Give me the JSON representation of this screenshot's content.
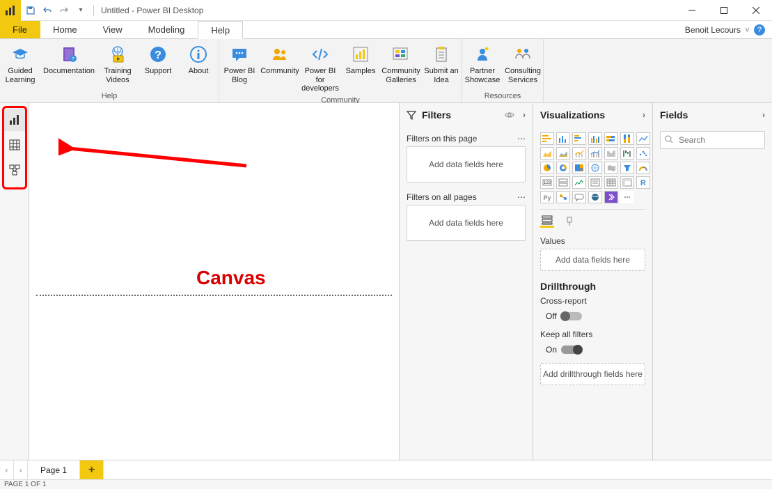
{
  "title": "Untitled - Power BI Desktop",
  "user": "Benoit Lecours",
  "menu": {
    "file": "File",
    "home": "Home",
    "view": "View",
    "modeling": "Modeling",
    "help": "Help"
  },
  "ribbon": {
    "groups": {
      "help": {
        "label": "Help",
        "guided_learning": "Guided Learning",
        "documentation": "Documentation",
        "training_videos": "Training Videos",
        "support": "Support",
        "about": "About"
      },
      "community": {
        "label": "Community",
        "power_bi_blog": "Power BI Blog",
        "community": "Community",
        "power_bi_developers": "Power BI for developers",
        "samples": "Samples",
        "community_galleries": "Community Galleries",
        "submit_idea": "Submit an Idea"
      },
      "resources": {
        "label": "Resources",
        "partner_showcase": "Partner Showcase",
        "consulting_services": "Consulting Services"
      }
    }
  },
  "canvas": {
    "annotation": "Canvas"
  },
  "filters": {
    "title": "Filters",
    "on_page": "Filters on this page",
    "all_pages": "Filters on all pages",
    "drop": "Add data fields here"
  },
  "viz": {
    "title": "Visualizations",
    "values": "Values",
    "values_drop": "Add data fields here",
    "drillthrough": "Drillthrough",
    "cross_report": "Cross-report",
    "off": "Off",
    "keep_filters": "Keep all filters",
    "on": "On",
    "drill_drop": "Add drillthrough fields here"
  },
  "fields": {
    "title": "Fields",
    "search_placeholder": "Search"
  },
  "pagetab": {
    "page1": "Page 1"
  },
  "status": "PAGE 1 OF 1"
}
